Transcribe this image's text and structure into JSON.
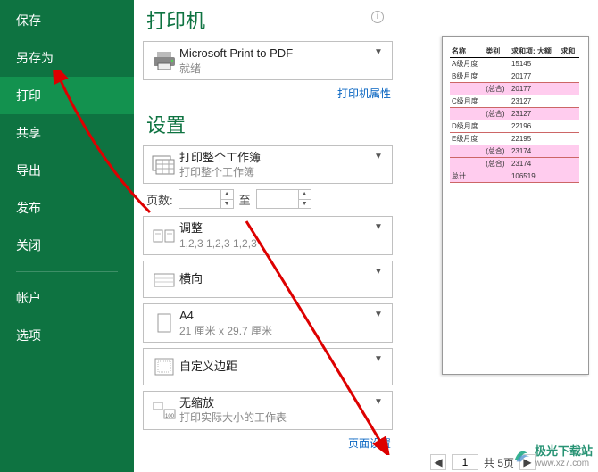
{
  "sidebar": {
    "items": [
      {
        "label": "保存"
      },
      {
        "label": "另存为"
      },
      {
        "label": "打印"
      },
      {
        "label": "共享"
      },
      {
        "label": "导出"
      },
      {
        "label": "发布"
      },
      {
        "label": "关闭"
      },
      {
        "label": "帐户"
      },
      {
        "label": "选项"
      }
    ]
  },
  "printer": {
    "section": "打印机",
    "name": "Microsoft Print to PDF",
    "status": "就绪",
    "props_link": "打印机属性"
  },
  "settings": {
    "section": "设置",
    "scope": {
      "title": "打印整个工作簿",
      "sub": "打印整个工作簿"
    },
    "pages": {
      "label": "页数:",
      "to": "至"
    },
    "collate": {
      "title": "调整",
      "sub": "1,2,3    1,2,3    1,2,3"
    },
    "orient": {
      "title": "横向",
      "sub": ""
    },
    "paper": {
      "title": "A4",
      "sub": "21 厘米 x 29.7 厘米"
    },
    "margin": {
      "title": "自定义边距",
      "sub": ""
    },
    "scale": {
      "title": "无缩放",
      "sub": "打印实际大小的工作表"
    },
    "page_setup": "页面设置"
  },
  "preview_table": {
    "headers": [
      "名称",
      "类别",
      "求和项: 大额",
      "求和"
    ],
    "rows": [
      [
        "A级月度",
        "",
        "15145",
        ""
      ],
      [
        "B级月度",
        "",
        "20177",
        ""
      ],
      [
        "",
        "(总合)",
        "20177",
        ""
      ],
      [
        "C级月度",
        "",
        "23127",
        ""
      ],
      [
        "",
        "(总合)",
        "23127",
        ""
      ],
      [
        "D级月度",
        "",
        "22196",
        ""
      ],
      [
        "E级月度",
        "",
        "22195",
        ""
      ],
      [
        "",
        "(总合)",
        "23174",
        ""
      ],
      [
        "",
        "(总合)",
        "23174",
        ""
      ],
      [
        "总计",
        "",
        "106519",
        ""
      ]
    ]
  },
  "footer": {
    "current": "1",
    "total_label": "共 5页"
  },
  "watermark": {
    "text": "极光下载站",
    "url": "www.xz7.com"
  }
}
